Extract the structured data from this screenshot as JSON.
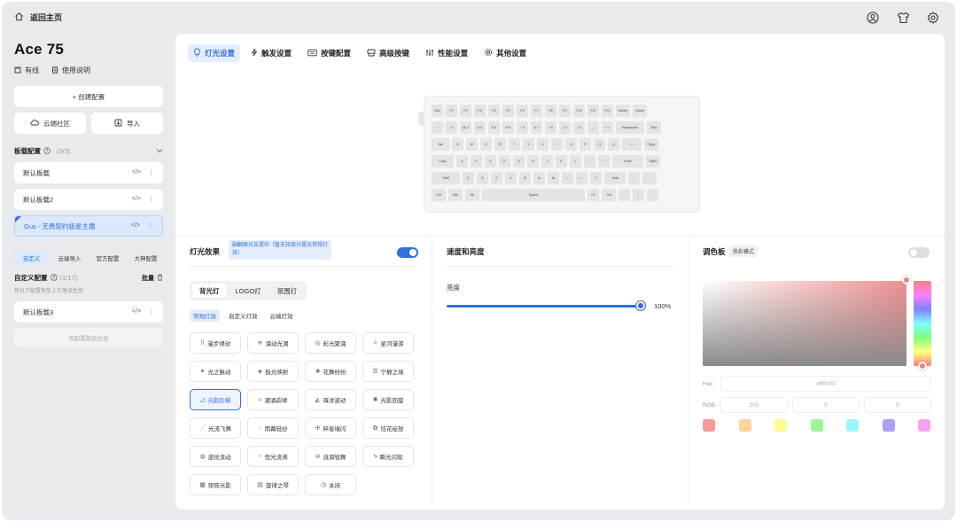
{
  "topbar": {
    "home_label": "返回主页"
  },
  "device": {
    "name": "Ace 75",
    "connection": "有线",
    "manual": "使用说明"
  },
  "sidebar": {
    "create_label": "+ 创建配置",
    "cloud_label": "云端社区",
    "import_label": "导入",
    "board_section": {
      "title": "板载配置",
      "count": "(3/3)"
    },
    "board_items": [
      "默认板载",
      "默认板载2",
      "Gus - 无畏契约极星主播"
    ],
    "filter_tabs": [
      "自定义",
      "云端导入",
      "官方配置",
      "大神配置"
    ],
    "custom_section": {
      "title": "自定义配置",
      "count": "(1/17)",
      "batch": "批量"
    },
    "custom_hint": "将以下配置拖至上方激活生效",
    "custom_items": [
      "默认板载3"
    ],
    "drop_hint": "将配置拖到此处"
  },
  "main_tabs": [
    "灯光设置",
    "触发设置",
    "按键配置",
    "高级按键",
    "性能设置",
    "其他设置"
  ],
  "keyboard": {
    "rows": [
      [
        "Esc",
        "F1",
        "F2",
        "F3",
        "F4",
        "F5",
        "F6",
        "F7",
        "F8",
        "F9",
        "F10",
        "F11",
        "F12",
        "Delete",
        "Home"
      ],
      [
        "~ `",
        "! 1",
        "@ 2",
        "# 3",
        "$ 4",
        "% 5",
        "^ 6",
        "& 7",
        "* 8",
        "( 9",
        ") 0",
        "_ -",
        "+ =",
        "Backspace",
        "End"
      ],
      [
        "Tab",
        "Q",
        "W",
        "E",
        "R",
        "T",
        "Y",
        "U",
        "I",
        "O",
        "P",
        "{ [",
        "} ]",
        "| \\",
        "PgUp"
      ],
      [
        "Caps",
        "A",
        "S",
        "D",
        "F",
        "G",
        "H",
        "J",
        "K",
        "L",
        ": ;",
        "\" '",
        "Enter",
        "PgDn"
      ],
      [
        "Shift",
        "Z",
        "X",
        "C",
        "V",
        "B",
        "N",
        "M",
        "< ,",
        "> .",
        "? /",
        "Shift",
        "↑",
        ""
      ],
      [
        "Ctrl",
        "Win",
        "Alt",
        "Space",
        "Fn",
        "Ctrl",
        "←",
        "↓",
        "→"
      ]
    ]
  },
  "light_panel": {
    "title": "灯光效果",
    "notice": "副翻屏光告提中（暂支持部分提光常规灯效）",
    "segments": [
      "背光灯",
      "LOGO灯",
      "氛围灯"
    ],
    "subtabs": [
      "常规灯效",
      "自定义灯效",
      "云端灯效"
    ],
    "effects": [
      {
        "icon": "⠿",
        "label": "漫步律动"
      },
      {
        "icon": "≋",
        "label": "涌动光潮"
      },
      {
        "icon": "◎",
        "label": "彩光聚涌"
      },
      {
        "icon": "✧",
        "label": "星河漫游"
      },
      {
        "icon": "✦",
        "label": "光之脉动"
      },
      {
        "icon": "◈",
        "label": "极光映射"
      },
      {
        "icon": "❀",
        "label": "花舞纷纷"
      },
      {
        "icon": "☰",
        "label": "宁静之境"
      },
      {
        "icon": "◿",
        "label": "光影阶梯"
      },
      {
        "icon": "≈",
        "label": "潮涌韵律"
      },
      {
        "icon": "◭",
        "label": "海洋波动"
      },
      {
        "icon": "✺",
        "label": "光影回旋"
      },
      {
        "icon": "⋰",
        "label": "光流飞舞"
      },
      {
        "icon": "◌",
        "label": "雨幕轻纱"
      },
      {
        "icon": "✣",
        "label": "碎星璀闪"
      },
      {
        "icon": "✿",
        "label": "炫花绽放"
      },
      {
        "icon": "◍",
        "label": "波纹流动"
      },
      {
        "icon": "◔",
        "label": "恒光流溯"
      },
      {
        "icon": "⊜",
        "label": "涟漪轻舞"
      },
      {
        "icon": "ϟ",
        "label": "瞬光闪现"
      },
      {
        "icon": "▦",
        "label": "矩阵光影"
      },
      {
        "icon": "▤",
        "label": "旋律之琴"
      },
      {
        "icon": "◷",
        "label": "关闭"
      }
    ]
  },
  "speed_panel": {
    "title": "速度和亮度",
    "brightness_label": "亮度",
    "brightness_value": "100%",
    "brightness": 100
  },
  "color_panel": {
    "title": "调色板",
    "badge": "热彩模式",
    "hex_label": "Hex",
    "hex_value": "#ff0000",
    "rgb_label": "RGB",
    "r": "255",
    "g": "0",
    "b": "0",
    "swatches": [
      "#f79a9a",
      "#fcd398",
      "#fdfb96",
      "#9ef495",
      "#98f7fb",
      "#a7a2f4",
      "#f9a0f2"
    ]
  },
  "colors": {
    "accent": "#2f6fe0",
    "accent_bg": "#e4edfc",
    "window_bg": "#e9eaee"
  }
}
